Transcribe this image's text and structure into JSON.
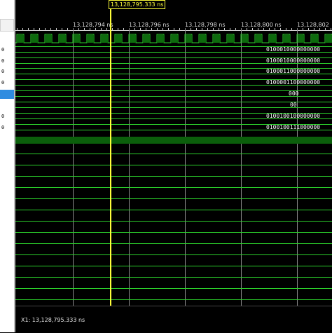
{
  "cursor": {
    "label": "13,128,795.333 ns"
  },
  "ruler": {
    "ticks": [
      "13,128,794 ns",
      "13,128,796 ns",
      "13,128,798 ns",
      "13,128,800 ns",
      "13,128,802"
    ]
  },
  "left_values": [
    "0",
    "0",
    "0",
    "0",
    "0",
    "0"
  ],
  "signals": {
    "bus_values": [
      "0100010000000000",
      "0100010000000000",
      "0100011000000000",
      "0100001100000000",
      "000",
      "00",
      "0100100100000000",
      "0100100111000000"
    ]
  },
  "status": {
    "text": "X1: 13,128,795.333 ns"
  },
  "colors": {
    "trace": "#2bd12b",
    "cursor": "#ffff3a",
    "band": "#0b5f0b",
    "selection": "#2f8ce0"
  }
}
